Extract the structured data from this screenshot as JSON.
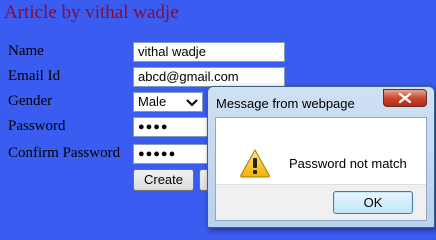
{
  "page": {
    "title": "Article by vithal wadje"
  },
  "form": {
    "name": {
      "label": "Name",
      "value": "vithal wadje"
    },
    "email": {
      "label": "Email Id",
      "value": "abcd@gmail.com"
    },
    "gender": {
      "label": "Gender",
      "selected": "Male"
    },
    "password": {
      "label": "Password",
      "value": "●●●●"
    },
    "confirm_password": {
      "label": "Confirm Password",
      "value": "●●●●●"
    },
    "create_label": "Create"
  },
  "dialog": {
    "title": "Message from webpage",
    "message": "Password not match",
    "ok_label": "OK",
    "icon": "warning-icon"
  },
  "colors": {
    "background": "#3a5cf0",
    "title_text": "#8b0a30",
    "close_button": "#c9482f"
  }
}
